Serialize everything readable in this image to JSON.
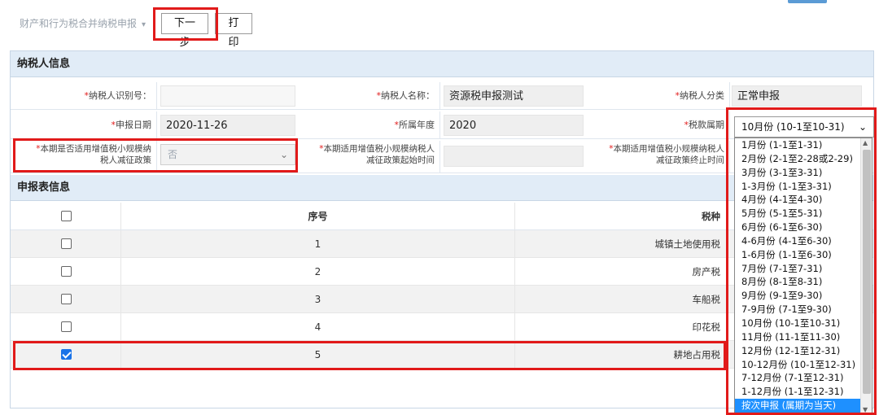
{
  "toolbar": {
    "form_dropdown": "财产和行为税合并纳税申报",
    "next_button": "下一步",
    "print_button": "打印"
  },
  "taxpayer_section": {
    "title": "纳税人信息",
    "id_label": "纳税人识别号：",
    "id_value": "",
    "name_label": "纳税人名称：",
    "name_value": "资源税申报测试",
    "category_label": "纳税人分类",
    "category_value": "正常申报",
    "date_label": "申报日期",
    "date_value": "2020-11-26",
    "year_label": "所属年度",
    "year_value": "2020",
    "period_label": "税款属期",
    "period_value": "10月份 (10-1至10-31)",
    "policy_label_1": "本期是否适用增值税小规模纳",
    "policy_label_2": "税人减征政策",
    "policy_value": "否",
    "start_label_1": "本期适用增值税小规模纳税人",
    "start_label_2": "减征政策起始时间",
    "end_label_1": "本期适用增值税小规模纳税人",
    "end_label_2": "减征政策终止时间"
  },
  "report_section": {
    "title": "申报表信息",
    "col_no": "序号",
    "col_tax": "税种",
    "rows": [
      {
        "no": "1",
        "tax": "城镇土地使用税",
        "checked": false
      },
      {
        "no": "2",
        "tax": "房产税",
        "checked": false
      },
      {
        "no": "3",
        "tax": "车船税",
        "checked": false
      },
      {
        "no": "4",
        "tax": "印花税",
        "checked": false
      },
      {
        "no": "5",
        "tax": "耕地占用税",
        "checked": true
      }
    ]
  },
  "period_options": [
    "1月份 (1-1至1-31)",
    "2月份 (2-1至2-28或2-29)",
    "3月份 (3-1至3-31)",
    "1-3月份 (1-1至3-31)",
    "4月份 (4-1至4-30)",
    "5月份 (5-1至5-31)",
    "6月份 (6-1至6-30)",
    "4-6月份 (4-1至6-30)",
    "1-6月份 (1-1至6-30)",
    "7月份 (7-1至7-31)",
    "8月份 (8-1至8-31)",
    "9月份 (9-1至9-30)",
    "7-9月份 (7-1至9-30)",
    "10月份 (10-1至10-31)",
    "11月份 (11-1至11-30)",
    "12月份 (12-1至12-31)",
    "10-12月份 (10-1至12-31)",
    "7-12月份 (7-1至12-31)",
    "1-12月份 (1-1至12-31)",
    "按次申报 (属期为当天)"
  ],
  "colors": {
    "highlight": "#e11a1a",
    "section_bg": "#e1ecf7",
    "selected_option": "#1e90ff"
  }
}
